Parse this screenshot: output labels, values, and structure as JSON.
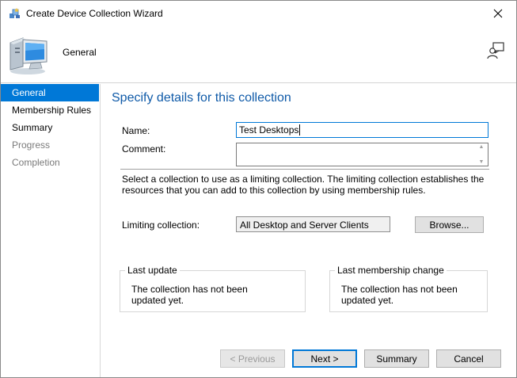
{
  "window": {
    "title": "Create Device Collection Wizard",
    "close_glyph": "✕"
  },
  "header": {
    "title": "General"
  },
  "nav": {
    "items": [
      {
        "label": "General",
        "state": "active"
      },
      {
        "label": "Membership Rules",
        "state": "normal"
      },
      {
        "label": "Summary",
        "state": "normal"
      },
      {
        "label": "Progress",
        "state": "disabled"
      },
      {
        "label": "Completion",
        "state": "disabled"
      }
    ]
  },
  "main": {
    "heading": "Specify details for this collection",
    "name_label": "Name:",
    "name_value": "Test Desktops",
    "comment_label": "Comment:",
    "comment_value": "",
    "description": "Select a collection to use as a limiting collection. The limiting collection establishes the resources that you can add to this collection by using membership rules.",
    "limiting_label": "Limiting collection:",
    "limiting_value": "All Desktop and Server Clients",
    "browse_label": "Browse...",
    "last_update": {
      "title": "Last update",
      "text": "The collection has not been updated yet."
    },
    "last_membership_change": {
      "title": "Last membership change",
      "text": "The collection has not been updated yet."
    }
  },
  "footer": {
    "previous_label": "< Previous",
    "next_label": "Next >",
    "summary_label": "Summary",
    "cancel_label": "Cancel"
  },
  "colors": {
    "accent": "#0078d7",
    "heading": "#0f5aa8"
  }
}
